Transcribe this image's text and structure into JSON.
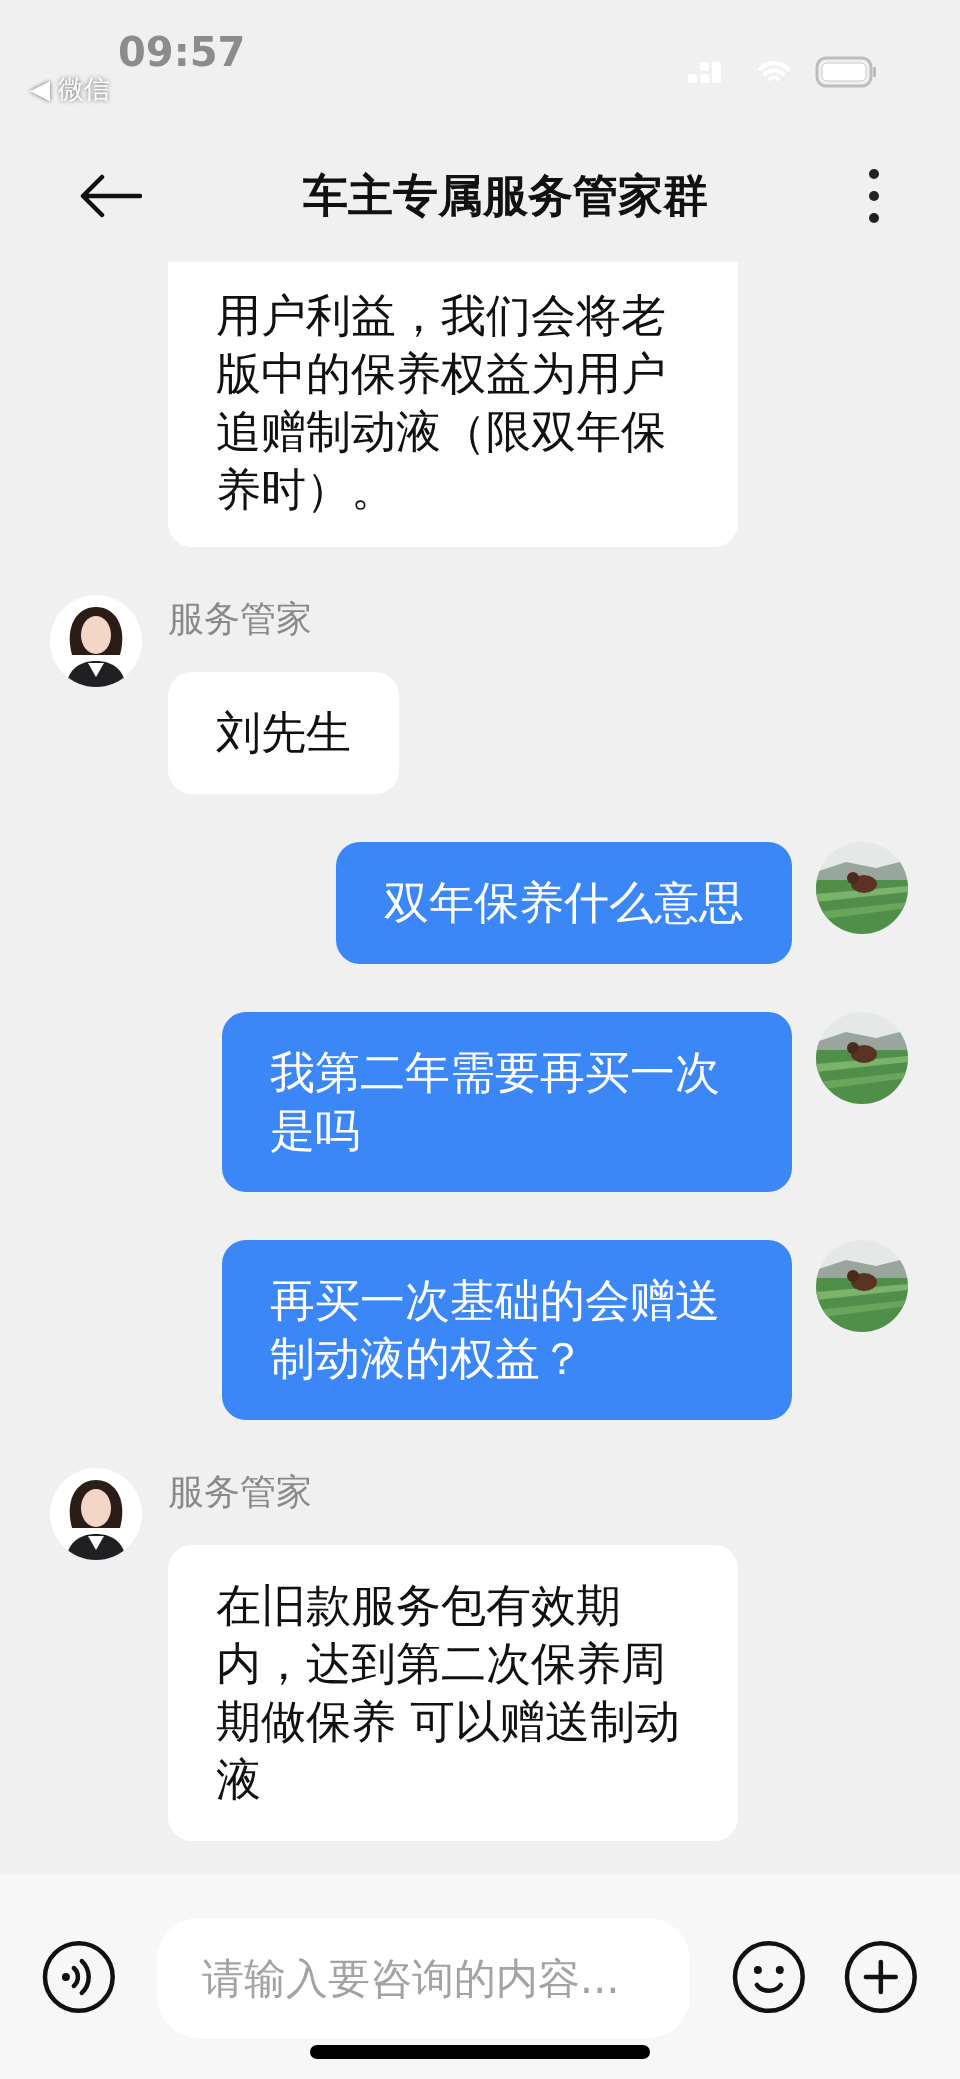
{
  "status_bar": {
    "time": "09:57",
    "back_app": "◀ 微信"
  },
  "header": {
    "title": "车主专属服务管家群"
  },
  "messages": [
    {
      "outgoing": false,
      "text": "用户利益，我们会将老版中的保养权益为用户追赠制动液（限双年保养时）。",
      "cut_top": true
    },
    {
      "outgoing": false,
      "sender": "服务管家",
      "text": "刘先生"
    },
    {
      "outgoing": true,
      "text": "双年保养什么意思"
    },
    {
      "outgoing": true,
      "text": "我第二年需要再买一次是吗"
    },
    {
      "outgoing": true,
      "text": "再买一次基础的会赠送制动液的权益？"
    },
    {
      "outgoing": false,
      "sender": "服务管家",
      "text": "在旧款服务包有效期内，达到第二次保养周期做保养 可以赠送制动液"
    }
  ],
  "input": {
    "placeholder": "请输入要咨询的内容..."
  }
}
